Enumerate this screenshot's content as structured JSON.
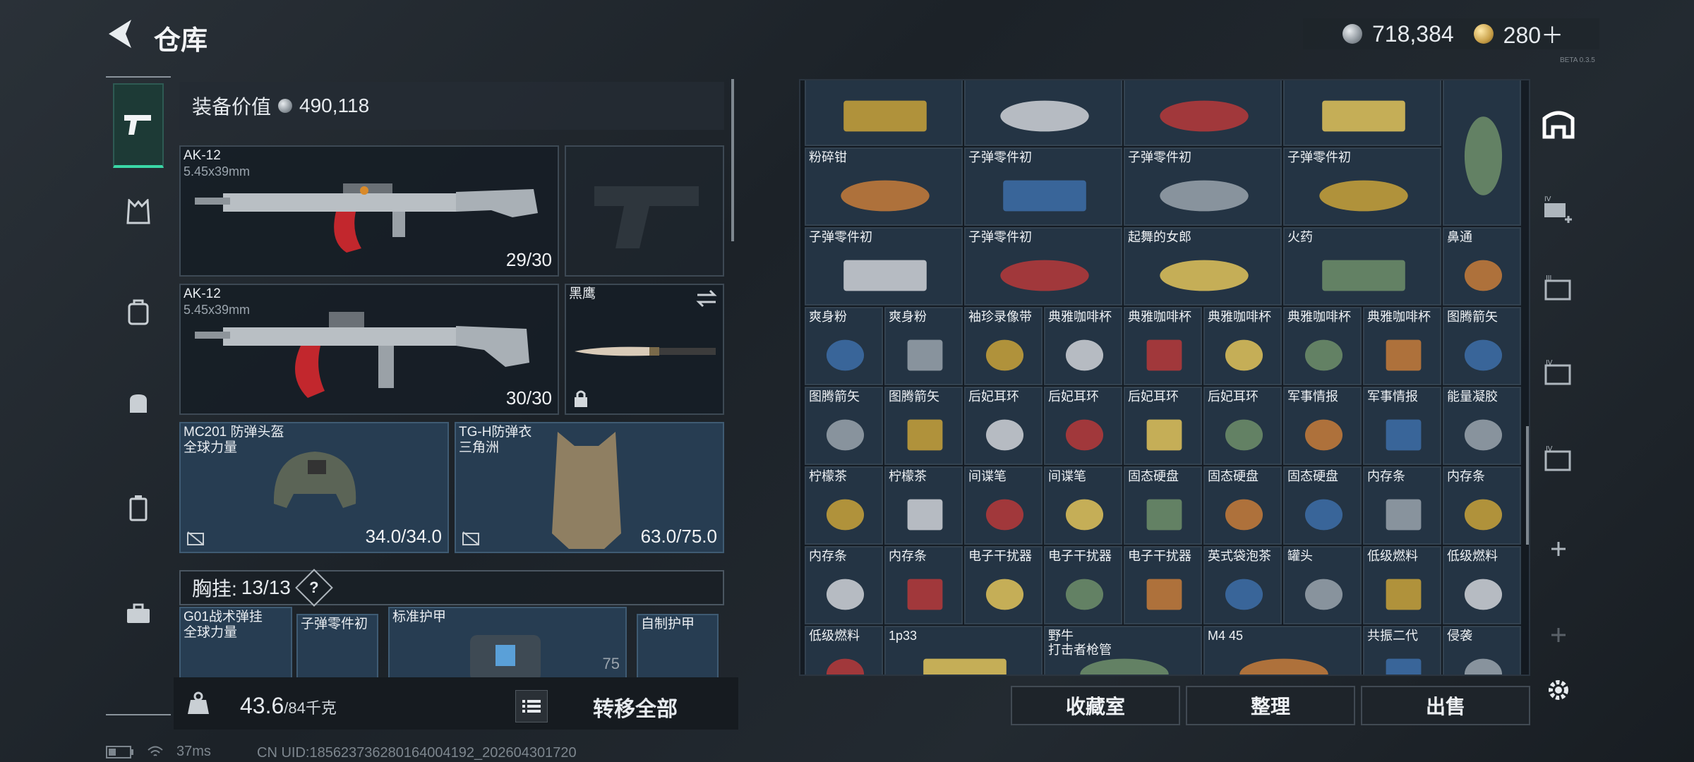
{
  "header": {
    "title": "仓库",
    "silver": "718,384",
    "gold": "280＋",
    "version_tag": "BETA 0.3.5"
  },
  "equipment": {
    "value_label": "装备价值",
    "value": "490,118",
    "primary1": {
      "name": "AK-12",
      "caliber": "5.45x39mm",
      "ammo": "29/30"
    },
    "primary2": {
      "name": "AK-12",
      "caliber": "5.45x39mm",
      "ammo": "30/30"
    },
    "melee": {
      "name": "黑鹰"
    },
    "helmet": {
      "name": "MC201 防弹头盔",
      "brand": "全球力量",
      "durability": "34.0/34.0"
    },
    "armor": {
      "name": "TG-H防弹衣",
      "brand": "三角洲",
      "durability": "63.0/75.0"
    },
    "chest_rig": {
      "label": "胸挂:",
      "count": "13/13",
      "help": "?"
    },
    "rig_items": [
      {
        "name": "G01战术弹挂",
        "sub": "全球力量"
      },
      {
        "name": "子弹零件初"
      },
      {
        "name": "标准护甲",
        "value": "75"
      },
      {
        "name": "自制护甲"
      }
    ],
    "weight": "43.6",
    "weight_unit": "/84千克",
    "transfer_all": "转移全部"
  },
  "status": {
    "ping": "37ms",
    "uid": "CN UID:18562373628016400419​2_202604301720"
  },
  "stash": {
    "items": [
      {
        "label": ""
      },
      {
        "label": ""
      },
      {
        "label": ""
      },
      {
        "label": ""
      },
      {
        "label": ""
      },
      {
        "label": "粉碎钳"
      },
      {
        "label": "子弹零件初"
      },
      {
        "label": "子弹零件初"
      },
      {
        "label": "子弹零件初"
      },
      {
        "label": "子弹零件初"
      },
      {
        "label": "子弹零件初"
      },
      {
        "label": "起舞的女郎"
      },
      {
        "label": "火药"
      },
      {
        "label": "鼻通"
      },
      {
        "label": "爽身粉"
      },
      {
        "label": "爽身粉"
      },
      {
        "label": "袖珍录像带"
      },
      {
        "label": "典雅咖啡杯"
      },
      {
        "label": "典雅咖啡杯"
      },
      {
        "label": "典雅咖啡杯"
      },
      {
        "label": "典雅咖啡杯"
      },
      {
        "label": "典雅咖啡杯"
      },
      {
        "label": "图腾箭矢"
      },
      {
        "label": "图腾箭矢"
      },
      {
        "label": "图腾箭矢"
      },
      {
        "label": "后妃耳环"
      },
      {
        "label": "后妃耳环"
      },
      {
        "label": "后妃耳环"
      },
      {
        "label": "后妃耳环"
      },
      {
        "label": "军事情报"
      },
      {
        "label": "军事情报"
      },
      {
        "label": "能量凝胶"
      },
      {
        "label": "柠檬茶"
      },
      {
        "label": "柠檬茶"
      },
      {
        "label": "间谍笔"
      },
      {
        "label": "间谍笔"
      },
      {
        "label": "固态硬盘"
      },
      {
        "label": "固态硬盘"
      },
      {
        "label": "固态硬盘"
      },
      {
        "label": "内存条"
      },
      {
        "label": "内存条"
      },
      {
        "label": "内存条"
      },
      {
        "label": "内存条"
      },
      {
        "label": "电子干扰器"
      },
      {
        "label": "电子干扰器"
      },
      {
        "label": "电子干扰器"
      },
      {
        "label": "英式袋泡茶"
      },
      {
        "label": "罐头"
      },
      {
        "label": "低级燃料"
      },
      {
        "label": "低级燃料"
      },
      {
        "label": "低级燃料"
      },
      {
        "label": "1p33"
      },
      {
        "label": "野牛",
        "sub": "打击者枪管"
      },
      {
        "label": "M4 45"
      },
      {
        "label": "共振二代"
      },
      {
        "label": "侵袭"
      }
    ],
    "buttons": {
      "collection": "收藏室",
      "sort": "整理",
      "sell": "出售"
    }
  }
}
